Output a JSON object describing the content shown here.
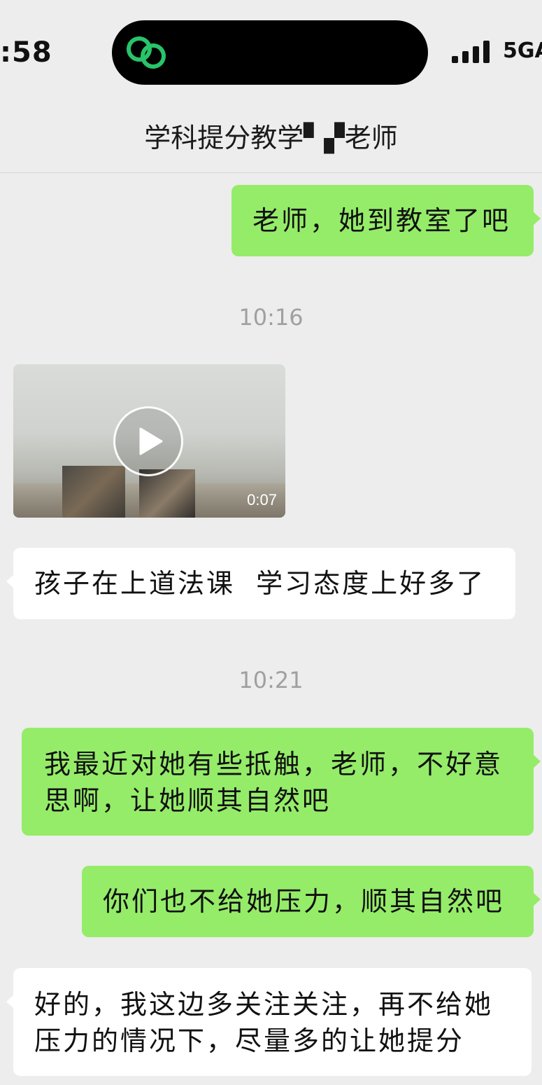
{
  "status_bar": {
    "time": ":58",
    "network": "5GA"
  },
  "nav": {
    "title": "学科提分教学▘▞老师"
  },
  "messages": [
    {
      "type": "text",
      "side": "sent",
      "text": "老师，她到教室了吧"
    },
    {
      "type": "timestamp",
      "text": "10:16"
    },
    {
      "type": "video",
      "side": "recv",
      "duration": "0:07"
    },
    {
      "type": "text",
      "side": "recv",
      "text": "孩子在上道法课  学习态度上好多了"
    },
    {
      "type": "timestamp",
      "text": "10:21"
    },
    {
      "type": "text",
      "side": "sent",
      "lines": [
        "我最近对她有些抵触，老师，不好意",
        "思啊，让她顺其自然吧"
      ]
    },
    {
      "type": "text",
      "side": "sent",
      "text": "你们也不给她压力，顺其自然吧"
    },
    {
      "type": "text",
      "side": "recv",
      "lines": [
        "好的，我这边多关注关注，再不给她",
        "压力的情况下，尽量多的让她提分"
      ]
    }
  ],
  "colors": {
    "background": "#ededed",
    "sent_bubble": "#95ec69",
    "recv_bubble": "#ffffff",
    "island_icon": "#29c36a"
  },
  "icons": [
    "app-link-icon",
    "signal-bars-icon",
    "play-icon"
  ]
}
